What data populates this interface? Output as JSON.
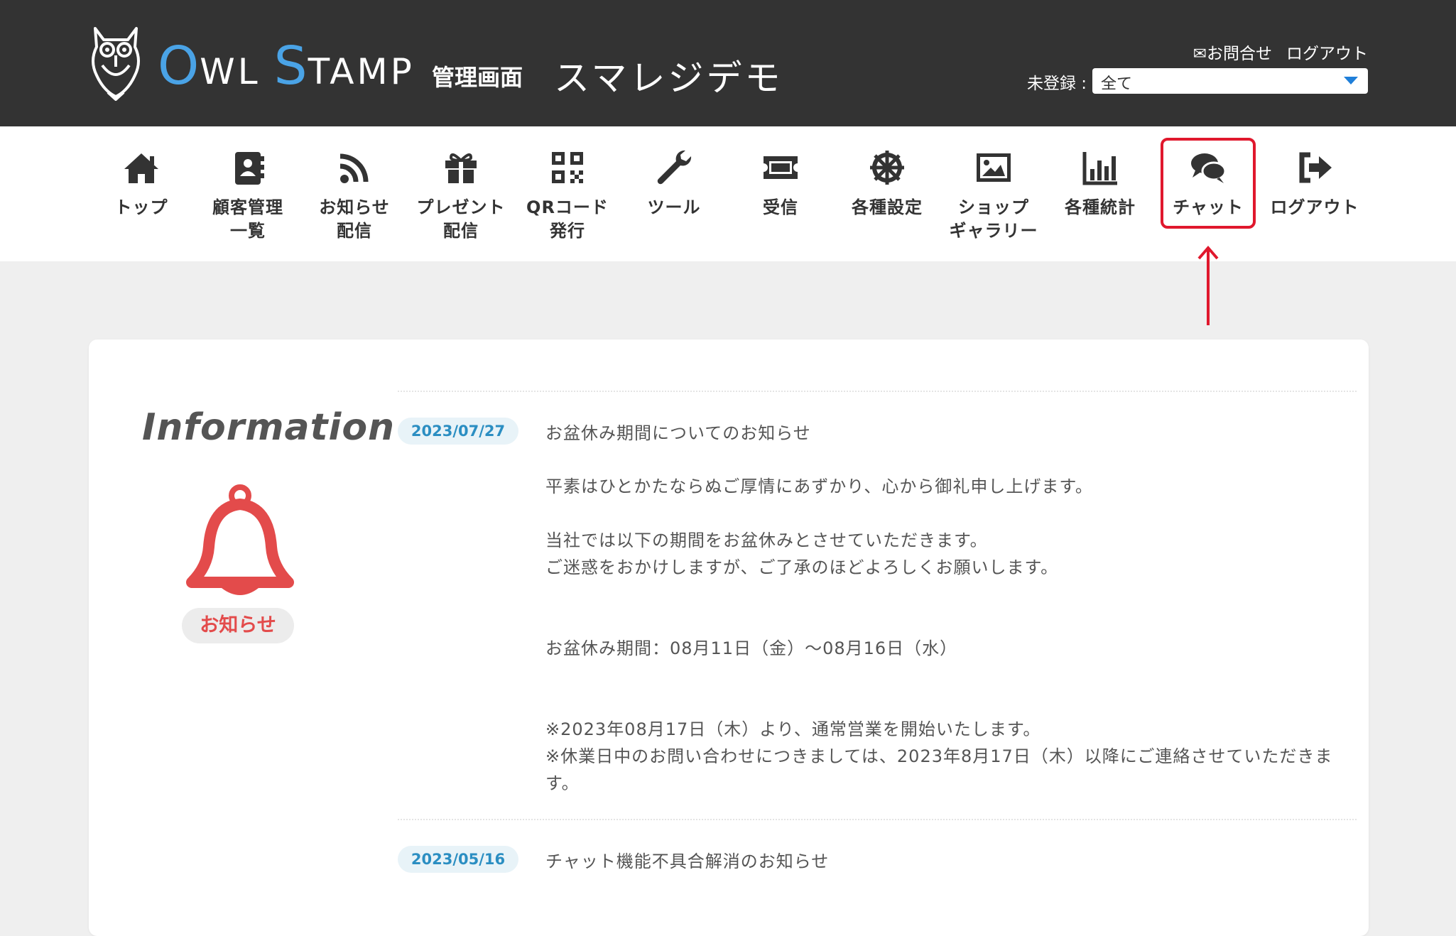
{
  "header": {
    "brand_owl": "O",
    "brand_wl": "WL",
    "brand_s": "S",
    "brand_tamp": "TAMP",
    "admin_label": "管理画面",
    "shop_name": "スマレジデモ",
    "contact_link": "✉お問合せ",
    "logout_link": "ログアウト",
    "unregistered_label": "未登録 :",
    "unregistered_select_value": "全て"
  },
  "nav": {
    "items": [
      {
        "label": "トップ",
        "icon": "home-icon"
      },
      {
        "label": "顧客管理\n一覧",
        "icon": "address-book-icon"
      },
      {
        "label": "お知らせ\n配信",
        "icon": "rss-icon"
      },
      {
        "label": "プレゼント\n配信",
        "icon": "gift-icon"
      },
      {
        "label": "QRコード\n発行",
        "icon": "qrcode-icon"
      },
      {
        "label": "ツール",
        "icon": "wrench-icon"
      },
      {
        "label": "受信",
        "icon": "ticket-icon"
      },
      {
        "label": "各種設定",
        "icon": "wheel-icon"
      },
      {
        "label": "ショップ\nギャラリー",
        "icon": "image-icon"
      },
      {
        "label": "各種統計",
        "icon": "bar-chart-icon"
      },
      {
        "label": "チャット",
        "icon": "chat-icon"
      },
      {
        "label": "ログアウト",
        "icon": "sign-out-icon"
      }
    ],
    "highlight_color": "#e0182d"
  },
  "information": {
    "title": "Information",
    "badge_label": "お知らせ",
    "news": [
      {
        "date": "2023/07/27",
        "title": "お盆休み期間についてのお知らせ",
        "body": [
          "平素はひとかたならぬご厚情にあずかり、心から御礼申し上げます。",
          "",
          "当社では以下の期間をお盆休みとさせていただきます。",
          "ご迷惑をおかけしますが、ご了承のほどよろしくお願いします。",
          "",
          "",
          "お盆休み期間：08月11日（金）〜08月16日（水）",
          "",
          "",
          "※2023年08月17日（木）より、通常営業を開始いたします。",
          "※休業日中のお問い合わせにつきましては、2023年8月17日（木）以降にご連絡させていただきま",
          "す。"
        ]
      },
      {
        "date": "2023/05/16",
        "title": "チャット機能不具合解消のお知らせ"
      }
    ]
  },
  "colors": {
    "header_bg": "#333333",
    "brand_blue": "#4aa3e6",
    "date_text": "#2b8ec2",
    "bell_red": "#e34b4b"
  }
}
